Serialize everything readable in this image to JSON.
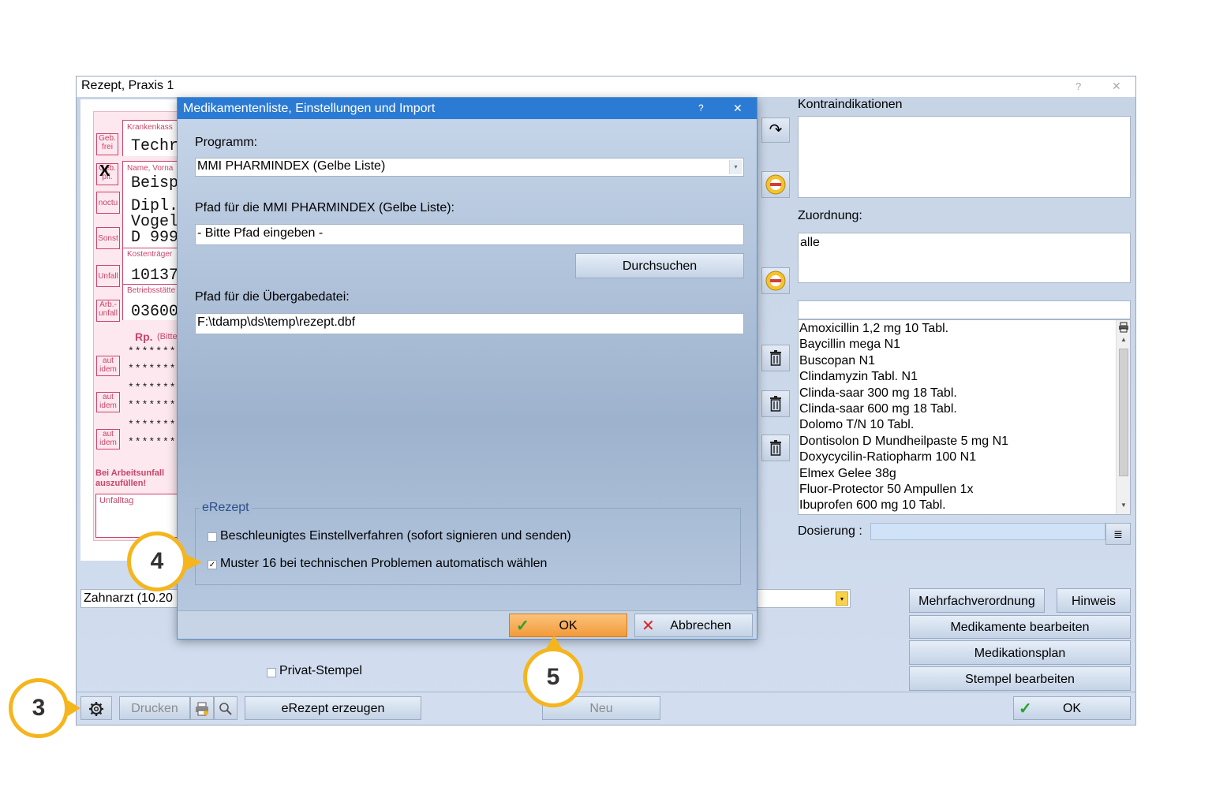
{
  "main_window": {
    "title": "Rezept, Praxis 1",
    "help_glyph": "?",
    "close_glyph": "✕"
  },
  "rx_form": {
    "krankenkasse_caption": "Krankenkass",
    "krankenkasse_value": "Techr",
    "name_caption": "Name, Vorna",
    "name_lines": [
      "Beisp",
      "Dipl.",
      "Vogel",
      "D 999"
    ],
    "kostentraeger_caption": "Kostenträger",
    "kostentraeger_value": "10137",
    "betriebsstaette_caption": "Betriebsstätte",
    "betriebsstaette_value": "03600",
    "rp_label": "Rp.",
    "rp_hint": "(Bitte",
    "side_boxes": [
      "Geb. frei",
      "Geb. pfl.",
      "noctu",
      "Sonst",
      "Unfall",
      "Arb.- unfall"
    ],
    "x_mark": "X",
    "aut_idem": [
      "aut idem",
      "aut idem",
      "aut idem"
    ],
    "stars": "*********",
    "warning": "Bei Arbeitsunfall auszufüllen!",
    "unfalltag_caption": "Unfalltag"
  },
  "zahnarzt_select": "Zahnarzt (10.20",
  "privat_stempel_label": "Privat-Stempel",
  "right_panel": {
    "kontraindikationen_label": "Kontraindikationen",
    "zuordnung_label": "Zuordnung:",
    "zuordnung_value": "alle",
    "search_value": "",
    "medications": [
      "Amoxicillin 1,2 mg 10 Tabl.",
      "Baycillin mega N1",
      "Buscopan N1",
      "Clindamyzin Tabl. N1",
      "Clinda-saar 300 mg 18 Tabl.",
      "Clinda-saar 600 mg 18 Tabl.",
      "Dolomo T/N 10 Tabl.",
      "Dontisolon D Mundheilpaste 5 mg N1",
      "Doxycycilin-Ratiopharm 100 N1",
      "Elmex Gelee 38g",
      "Fluor-Protector 50 Ampullen 1x",
      "Ibuprofen 600 mg 10 Tabl."
    ],
    "dosierung_label": "Dosierung :",
    "dosierung_value": ""
  },
  "right_buttons": {
    "mehrfachverordnung": "Mehrfachverordnung",
    "hinweis": "Hinweis",
    "medikamente_bearbeiten": "Medikamente bearbeiten",
    "medikationsplan": "Medikationsplan",
    "stempel_bearbeiten": "Stempel bearbeiten"
  },
  "bottom_bar": {
    "drucken": "Drucken",
    "erezept_erzeugen": "eRezept erzeugen",
    "neu": "Neu",
    "ok": "OK"
  },
  "dialog": {
    "title": "Medikamentenliste, Einstellungen und Import",
    "help_glyph": "?",
    "close_glyph": "✕",
    "programm_label": "Programm:",
    "programm_value": "MMI PHARMINDEX (Gelbe Liste)",
    "pfad_label": "Pfad für die MMI PHARMINDEX (Gelbe Liste):",
    "pfad_value": "- Bitte Pfad eingeben -",
    "durchsuchen": "Durchsuchen",
    "uebergabe_label": "Pfad für die Übergabedatei:",
    "uebergabe_value": "F:\\tdamp\\ds\\temp\\rezept.dbf",
    "erezept_group": "eRezept",
    "option1_label": "Beschleunigtes Einstellverfahren (sofort signieren und senden)",
    "option1_checked": false,
    "option2_label": "Muster 16 bei technischen Problemen automatisch wählen",
    "option2_checked": true,
    "ok": "OK",
    "abbrechen": "Abbrechen"
  },
  "callouts": [
    "3",
    "4",
    "5"
  ],
  "colors": {
    "dialog_title": "#2b7bd4",
    "callout_ring": "#f5b51d",
    "ok_button": "#f6a84a",
    "rx_pink": "#c9446a"
  }
}
